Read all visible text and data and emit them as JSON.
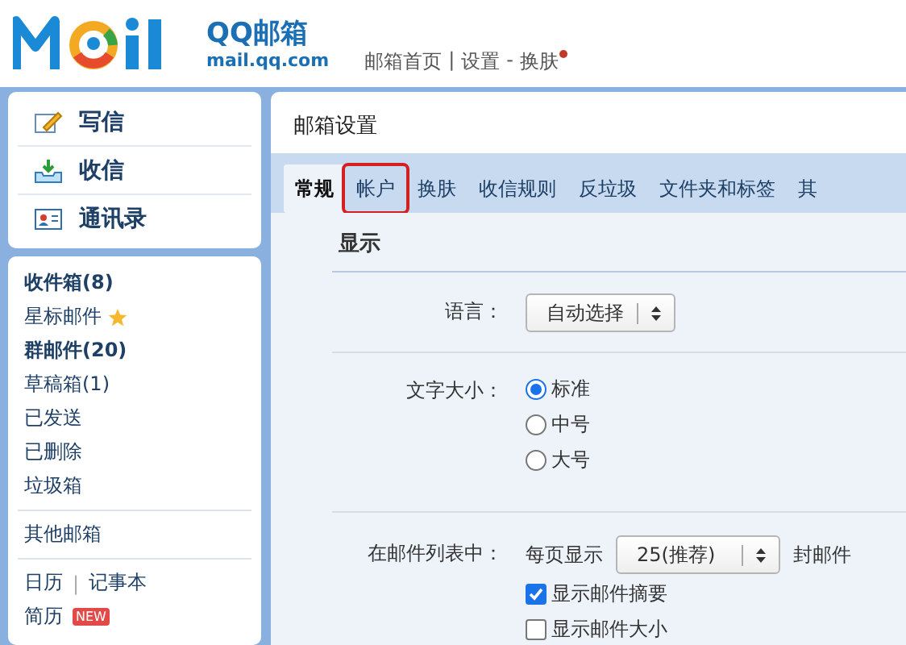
{
  "header": {
    "logo_text": "QQ邮箱",
    "logo_url": "mail.qq.com",
    "nav": [
      {
        "label": "邮箱首页",
        "kind": "link"
      },
      {
        "label": "|",
        "kind": "sep"
      },
      {
        "label": "设置",
        "kind": "link"
      },
      {
        "label": "-",
        "kind": "sep"
      },
      {
        "label": "换肤",
        "kind": "link",
        "dot": true
      }
    ]
  },
  "actions": [
    {
      "label": "写信",
      "kind": "compose"
    },
    {
      "label": "收信",
      "kind": "inbox"
    },
    {
      "label": "通讯录",
      "kind": "contacts"
    }
  ],
  "folders": [
    {
      "label": "收件箱(8)",
      "bold": true,
      "star": false
    },
    {
      "label": "星标邮件",
      "bold": false,
      "star": true
    },
    {
      "label": "群邮件(20)",
      "bold": true,
      "star": false
    },
    {
      "label": "草稿箱(1)",
      "bold": false,
      "star": false
    },
    {
      "label": "已发送",
      "bold": false,
      "star": false
    },
    {
      "label": "已删除",
      "bold": false,
      "star": false
    },
    {
      "label": "垃圾箱",
      "bold": false,
      "star": false
    }
  ],
  "other_mailbox": "其他邮箱",
  "tools": [
    {
      "label": "日历"
    },
    {
      "label": "|",
      "kind": "sep"
    },
    {
      "label": "记事本"
    },
    {
      "label": "简历",
      "badge": "NEW"
    }
  ],
  "settings": {
    "title": "邮箱设置",
    "tabs": [
      {
        "label": "常规",
        "selected": true,
        "highlighted": false
      },
      {
        "label": "帐户",
        "selected": false,
        "highlighted": true
      },
      {
        "label": "换肤",
        "selected": false,
        "highlighted": false
      },
      {
        "label": "收信规则",
        "selected": false,
        "highlighted": false
      },
      {
        "label": "反垃圾",
        "selected": false,
        "highlighted": false
      },
      {
        "label": "文件夹和标签",
        "selected": false,
        "highlighted": false
      },
      {
        "label": "其",
        "selected": false,
        "highlighted": false
      }
    ],
    "section": "显示",
    "language": {
      "label": "语言：",
      "value": "自动选择"
    },
    "font_size": {
      "label": "文字大小：",
      "options": [
        {
          "label": "标准",
          "selected": true
        },
        {
          "label": "中号",
          "selected": false
        },
        {
          "label": "大号",
          "selected": false
        }
      ]
    },
    "mail_list": {
      "label": "在邮件列表中：",
      "prefix": "每页显示",
      "value": "25(推荐)",
      "suffix": "封邮件",
      "checks": [
        {
          "label": "显示邮件摘要",
          "checked": true
        },
        {
          "label": "显示邮件大小",
          "checked": false
        }
      ]
    }
  }
}
